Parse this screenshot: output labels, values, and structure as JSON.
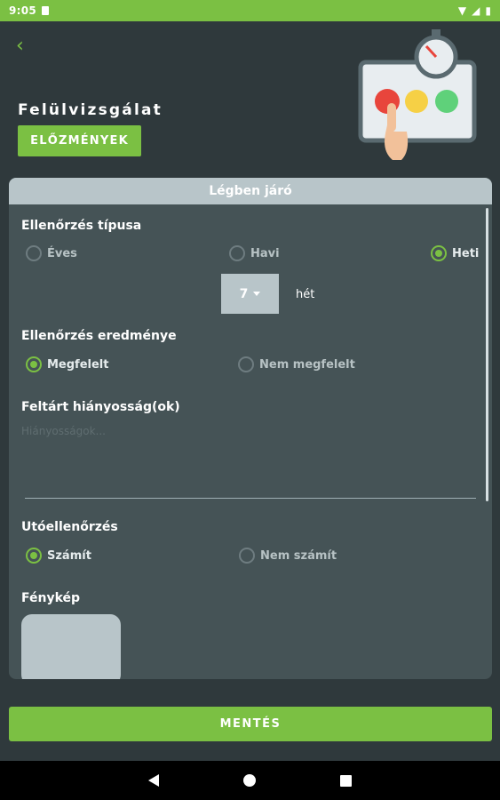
{
  "status_bar": {
    "time": "9:05"
  },
  "header": {
    "title": "Felülvizsgálat",
    "history_button": "ELŐZMÉNYEK"
  },
  "card": {
    "title": "Légben járó",
    "inspection_type": {
      "label": "Ellenőrzés típusa",
      "options": [
        "Éves",
        "Havi",
        "Heti"
      ],
      "selected": "Heti"
    },
    "week": {
      "value": "7",
      "unit": "hét"
    },
    "inspection_result": {
      "label": "Ellenőrzés eredménye",
      "options": [
        "Megfelelt",
        "Nem megfelelt"
      ],
      "selected": "Megfelelt"
    },
    "deficiencies": {
      "label": "Feltárt hiányosság(ok)",
      "placeholder": "Hiányosságok..."
    },
    "follow_up": {
      "label": "Utóellenőrzés",
      "options": [
        "Számít",
        "Nem számít"
      ],
      "selected": "Számít"
    },
    "photo": {
      "label": "Fénykép"
    }
  },
  "save_button": "MENTÉS",
  "colors": {
    "accent": "#7bc043",
    "background": "#2f393c",
    "card": "#455356",
    "header_strip": "#b8c5c9"
  }
}
